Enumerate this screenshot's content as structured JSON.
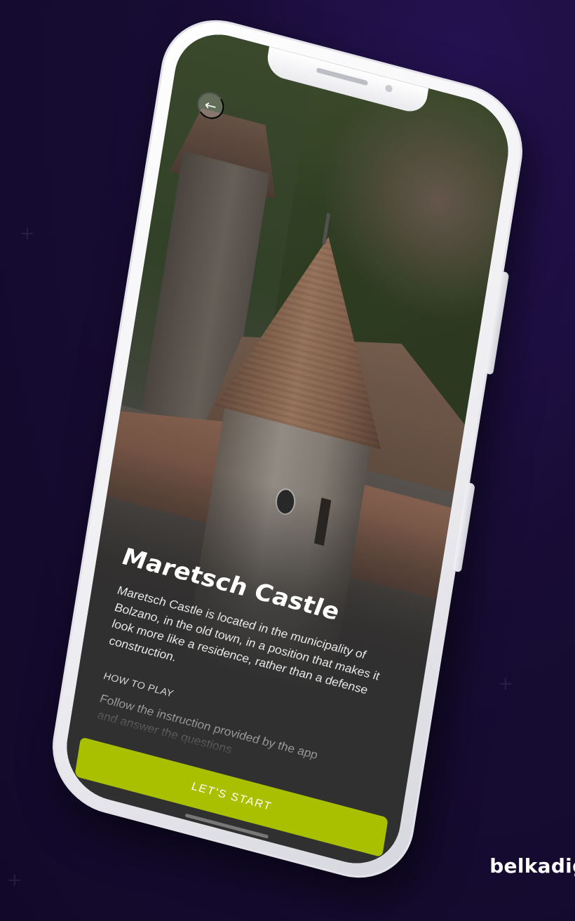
{
  "brand": {
    "name": "belkadigit"
  },
  "app": {
    "back_icon": "arrow-left-icon",
    "title": "Maretsch Castle",
    "description": "Maretsch Castle is located in the municipality of Bolzano, in the old town, in a position that makes it look more like a residence, rather than a defense construction.",
    "how_to_play_label": "HOW TO PLAY",
    "how_to_play_text": "Follow the instruction provided by the app and answer the questions",
    "start_button": "LET'S START"
  },
  "colors": {
    "background": "#170c33",
    "accent": "#a9c000",
    "panel": "#303030"
  }
}
